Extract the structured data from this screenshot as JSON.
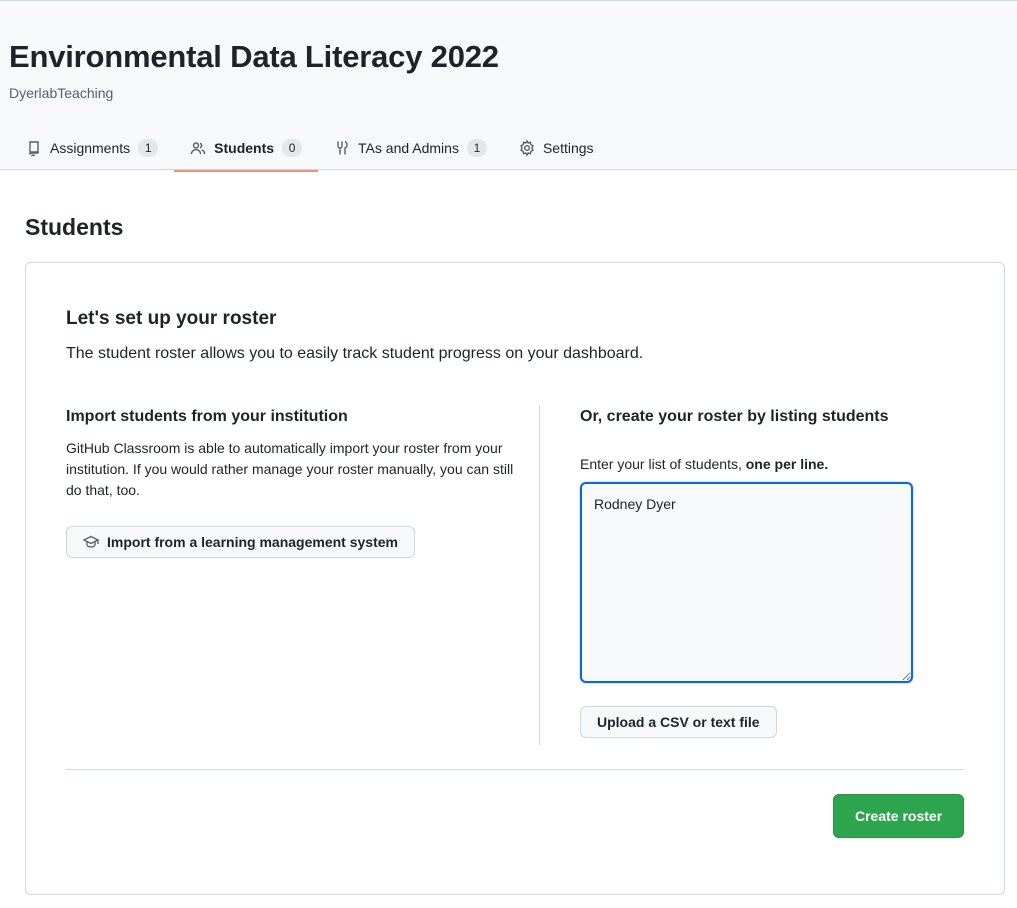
{
  "header": {
    "title": "Environmental Data Literacy 2022",
    "org": "DyerlabTeaching"
  },
  "tabs": [
    {
      "label": "Assignments",
      "count": "1",
      "icon": "book-icon",
      "active": false
    },
    {
      "label": "Students",
      "count": "0",
      "icon": "people-icon",
      "active": true
    },
    {
      "label": "TAs and Admins",
      "count": "1",
      "icon": "tools-icon",
      "active": false
    },
    {
      "label": "Settings",
      "count": null,
      "icon": "gear-icon",
      "active": false
    }
  ],
  "section_title": "Students",
  "panel": {
    "heading": "Let's set up your roster",
    "description": "The student roster allows you to easily track student progress on your dashboard.",
    "import": {
      "title": "Import students from your institution",
      "text": "GitHub Classroom is able to automatically import your roster from your institution. If you would rather manage your roster manually, you can still do that, too.",
      "button_label": "Import from a learning management system",
      "button_icon": "mortarboard-icon"
    },
    "manual": {
      "title": "Or, create your roster by listing students",
      "label_prefix": "Enter your list of students,",
      "label_emphasis": "one per line.",
      "textarea_value": "Rodney Dyer\n",
      "upload_label": "Upload a CSV or text file"
    },
    "create_label": "Create roster"
  },
  "colors": {
    "accent_tab_underline": "#fd8c73",
    "primary_button": "#2da44e",
    "focus_border": "#0969da"
  }
}
